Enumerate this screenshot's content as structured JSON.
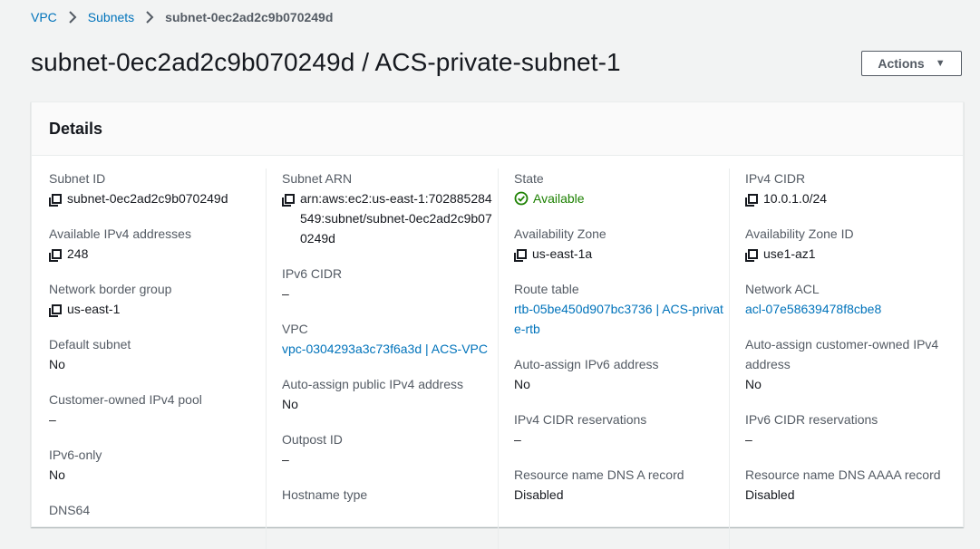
{
  "breadcrumb": {
    "items": [
      "VPC",
      "Subnets"
    ],
    "current": "subnet-0ec2ad2c9b070249d"
  },
  "page": {
    "title": "subnet-0ec2ad2c9b070249d / ACS-private-subnet-1",
    "actions_label": "Actions"
  },
  "details": {
    "title": "Details",
    "columns": [
      [
        {
          "label": "Subnet ID",
          "value": "subnet-0ec2ad2c9b070249d",
          "icon": "copy-icon"
        },
        {
          "label": "Available IPv4 addresses",
          "value": "248",
          "icon": "copy-icon"
        },
        {
          "label": "Network border group",
          "value": "us-east-1",
          "icon": "copy-icon"
        },
        {
          "label": "Default subnet",
          "value": "No"
        },
        {
          "label": "Customer-owned IPv4 pool",
          "value": "–"
        },
        {
          "label": "IPv6-only",
          "value": "No"
        },
        {
          "label": "DNS64",
          "value": ""
        }
      ],
      [
        {
          "label": "Subnet ARN",
          "value": "arn:aws:ec2:us-east-1:702885284549:subnet/subnet-0ec2ad2c9b070249d",
          "icon": "copy-icon"
        },
        {
          "label": "IPv6 CIDR",
          "value": "–"
        },
        {
          "label": "VPC",
          "value": "vpc-0304293a3c73f6a3d | ACS-VPC",
          "link": true
        },
        {
          "label": "Auto-assign public IPv4 address",
          "value": "No"
        },
        {
          "label": "Outpost ID",
          "value": "–"
        },
        {
          "label": "Hostname type",
          "value": ""
        }
      ],
      [
        {
          "label": "State",
          "value": "Available",
          "icon": "check-circle-icon",
          "status": "ok"
        },
        {
          "label": "Availability Zone",
          "value": "us-east-1a",
          "icon": "copy-icon"
        },
        {
          "label": "Route table",
          "value": "rtb-05be450d907bc3736 | ACS-private-rtb",
          "link": true
        },
        {
          "label": "Auto-assign IPv6 address",
          "value": "No"
        },
        {
          "label": "IPv4 CIDR reservations",
          "value": "–"
        },
        {
          "label": "Resource name DNS A record",
          "value": "Disabled"
        }
      ],
      [
        {
          "label": "IPv4 CIDR",
          "value": "10.0.1.0/24",
          "icon": "copy-icon"
        },
        {
          "label": "Availability Zone ID",
          "value": "use1-az1",
          "icon": "copy-icon"
        },
        {
          "label": "Network ACL",
          "value": "acl-07e58639478f8cbe8",
          "link": true
        },
        {
          "label": "Auto-assign customer-owned IPv4 address",
          "value": "No"
        },
        {
          "label": "IPv6 CIDR reservations",
          "value": "–"
        },
        {
          "label": "Resource name DNS AAAA record",
          "value": "Disabled"
        }
      ]
    ]
  },
  "colors": {
    "link": "#0073bb",
    "success": "#1d8102",
    "label": "#545b64",
    "text": "#16191f"
  }
}
